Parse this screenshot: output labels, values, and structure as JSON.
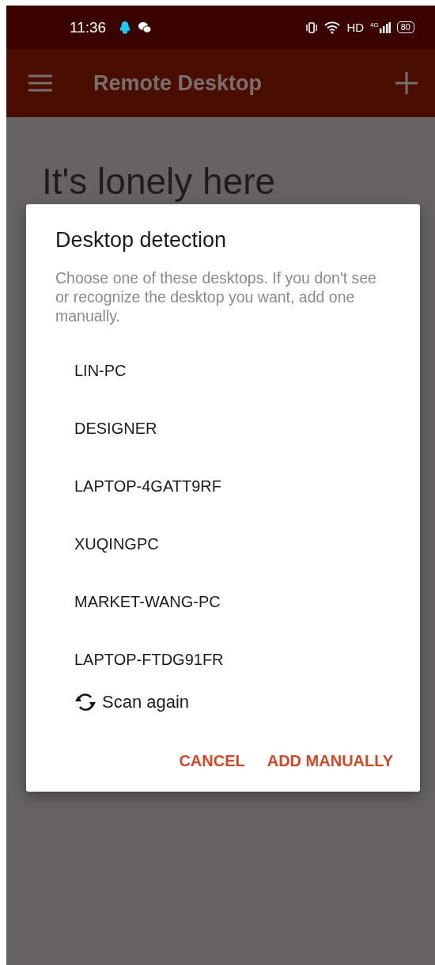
{
  "status_bar": {
    "time": "11:36",
    "network_label": "HD",
    "cell_label": "4G",
    "battery": "80"
  },
  "app_bar": {
    "title": "Remote Desktop"
  },
  "empty_state": {
    "heading": "It's lonely here"
  },
  "dialog": {
    "title": "Desktop detection",
    "message": "Choose one of these desktops. If you don't see or recognize the desktop you want, add one manually.",
    "desktops": [
      {
        "name": "LIN-PC"
      },
      {
        "name": "DESIGNER"
      },
      {
        "name": "LAPTOP-4GATT9RF"
      },
      {
        "name": "XUQINGPC"
      },
      {
        "name": "MARKET-WANG-PC"
      },
      {
        "name": "LAPTOP-FTDG91FR"
      }
    ],
    "scan_again": "Scan again",
    "buttons": [
      {
        "label": "CANCEL"
      },
      {
        "label": "ADD MANUALLY"
      }
    ]
  }
}
